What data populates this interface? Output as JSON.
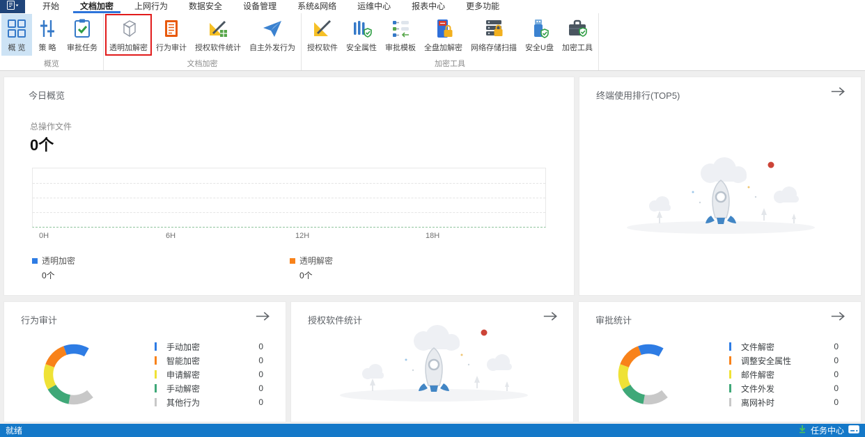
{
  "menu": {
    "app_button_icon": "app-window-icon",
    "tabs": [
      {
        "label": "开始",
        "active": false
      },
      {
        "label": "文档加密",
        "active": true
      },
      {
        "label": "上网行为",
        "active": false
      },
      {
        "label": "数据安全",
        "active": false
      },
      {
        "label": "设备管理",
        "active": false
      },
      {
        "label": "系统&网络",
        "active": false
      },
      {
        "label": "运维中心",
        "active": false
      },
      {
        "label": "报表中心",
        "active": false
      },
      {
        "label": "更多功能",
        "active": false
      }
    ]
  },
  "ribbon": {
    "groups": [
      {
        "label": "概览",
        "buttons": [
          {
            "label": "概 览",
            "icon": "overview-grid",
            "selected": true
          },
          {
            "label": "策 略",
            "icon": "policy-sliders"
          },
          {
            "label": "审批任务",
            "icon": "approval-tasks-clipboard"
          }
        ]
      },
      {
        "label": "文档加密",
        "buttons": [
          {
            "label": "透明加解密",
            "icon": "transparent-encryption-cube",
            "highlighted": true
          },
          {
            "label": "行为审计",
            "icon": "behavior-audit-document"
          },
          {
            "label": "授权软件统计",
            "icon": "authorized-software-stats"
          },
          {
            "label": "自主外发行为",
            "icon": "self-outgoing-paper-plane"
          }
        ]
      },
      {
        "label": "加密工具",
        "buttons": [
          {
            "label": "授权软件",
            "icon": "authorized-software"
          },
          {
            "label": "安全属性",
            "icon": "security-attributes-fence"
          },
          {
            "label": "审批模板",
            "icon": "approval-template"
          },
          {
            "label": "全盘加解密",
            "icon": "full-disk-encryption-ssd"
          },
          {
            "label": "网络存储扫描",
            "icon": "network-storage-scan"
          },
          {
            "label": "安全U盘",
            "icon": "secure-usb-drive"
          },
          {
            "label": "加密工具",
            "icon": "encryption-toolbox"
          }
        ]
      }
    ]
  },
  "cards": {
    "today": {
      "title": "今日概览",
      "metric_label": "总操作文件",
      "metric_value": "0个",
      "x_ticks": [
        "0H",
        "6H",
        "12H",
        "18H"
      ],
      "legend": [
        {
          "label": "透明加密",
          "value": "0个",
          "color": "#2e7ce4"
        },
        {
          "label": "透明解密",
          "value": "0个",
          "color": "#f8821a"
        }
      ]
    },
    "terminal_rank": {
      "title": "终端使用排行(TOP5)"
    },
    "behavior_audit": {
      "title": "行为审计",
      "legend": [
        {
          "label": "手动加密",
          "value": "0",
          "color": "#2e7ce4"
        },
        {
          "label": "智能加密",
          "value": "0",
          "color": "#f8821a"
        },
        {
          "label": "申请解密",
          "value": "0",
          "color": "#efe236"
        },
        {
          "label": "手动解密",
          "value": "0",
          "color": "#3fa878"
        },
        {
          "label": "其他行为",
          "value": "0",
          "color": "#c8c8c8"
        }
      ]
    },
    "authorized_software": {
      "title": "授权软件统计"
    },
    "approval_stats": {
      "title": "审批统计",
      "legend": [
        {
          "label": "文件解密",
          "value": "0",
          "color": "#2e7ce4"
        },
        {
          "label": "调整安全属性",
          "value": "0",
          "color": "#f8821a"
        },
        {
          "label": "邮件解密",
          "value": "0",
          "color": "#efe236"
        },
        {
          "label": "文件外发",
          "value": "0",
          "color": "#3fa878"
        },
        {
          "label": "离网补时",
          "value": "0",
          "color": "#c8c8c8"
        }
      ]
    }
  },
  "status_bar": {
    "left": "就绪",
    "task_center": "任务中心"
  },
  "colors": {
    "accent_blue": "#2d74da",
    "highlight_red": "#e11b1b",
    "ribbon_selected_bg": "#cde3f5",
    "status_bar_bg": "#1478c8",
    "download_green": "#49c25b",
    "empty_dot_red": "#cc4437"
  },
  "chart_data": [
    {
      "type": "line",
      "title": "今日概览",
      "xlabel": "hour of day",
      "x_ticks": [
        "0H",
        "6H",
        "12H",
        "18H"
      ],
      "x_range": [
        "0H",
        "24H"
      ],
      "series": [
        {
          "name": "透明加密",
          "color": "#2e7ce4",
          "values": [],
          "total": "0个"
        },
        {
          "name": "透明解密",
          "color": "#f8821a",
          "values": [],
          "total": "0个"
        }
      ],
      "grid": "horizontal dashed",
      "note": "empty - no data plotted"
    },
    {
      "type": "pie",
      "title": "行为审计",
      "categories": [
        "手动加密",
        "智能加密",
        "申请解密",
        "手动解密",
        "其他行为"
      ],
      "values": [
        0,
        0,
        0,
        0,
        0
      ],
      "colors": [
        "#2e7ce4",
        "#f8821a",
        "#efe236",
        "#3fa878",
        "#c8c8c8"
      ],
      "style": "donut placeholder with equal segments, gap at right side",
      "legend_position": "right"
    },
    {
      "type": "pie",
      "title": "审批统计",
      "categories": [
        "文件解密",
        "调整安全属性",
        "邮件解密",
        "文件外发",
        "离网补时"
      ],
      "values": [
        0,
        0,
        0,
        0,
        0
      ],
      "colors": [
        "#2e7ce4",
        "#f8821a",
        "#efe236",
        "#3fa878",
        "#c8c8c8"
      ],
      "style": "donut placeholder with equal segments, gap at right side",
      "legend_position": "right"
    }
  ]
}
